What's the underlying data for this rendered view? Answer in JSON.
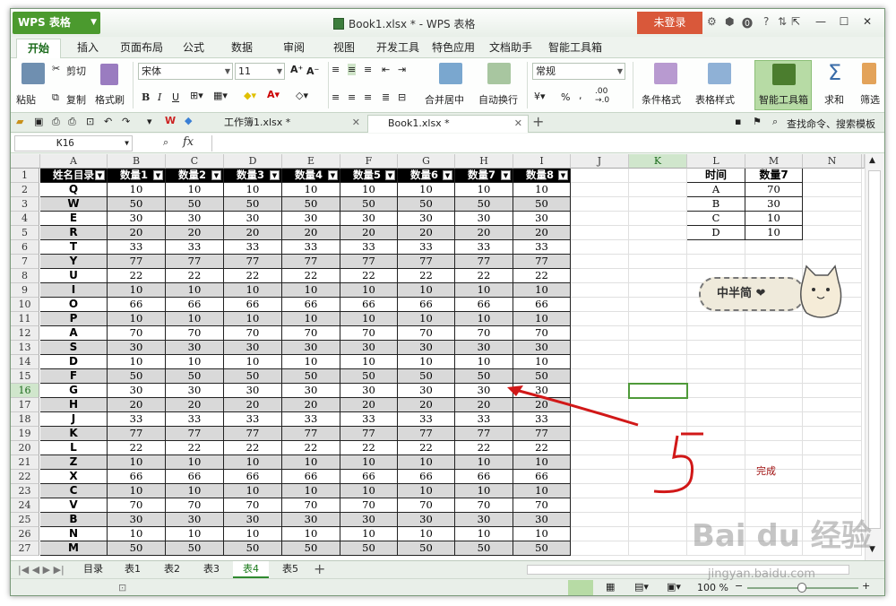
{
  "app": {
    "name": "WPS 表格",
    "window_title": "Book1.xlsx * - WPS 表格",
    "login": "未登录"
  },
  "menu": [
    "开始",
    "插入",
    "页面布局",
    "公式",
    "数据",
    "审阅",
    "视图",
    "开发工具",
    "特色应用",
    "文档助手",
    "智能工具箱"
  ],
  "ribbon": {
    "paste": "粘贴",
    "cut": "剪切",
    "copy": "复制",
    "format_painter": "格式刷",
    "font": "宋体",
    "size": "11",
    "bold": "B",
    "italic": "I",
    "underline": "U",
    "merge": "合并居中",
    "wrap": "自动换行",
    "number_format": "常规",
    "percent": "%",
    "comma": ",",
    "dec_inc": ".00",
    "dec_dec": "→.0",
    "cond_format": "条件格式",
    "table_style": "表格样式",
    "smart_box": "智能工具箱",
    "sum": "求和",
    "filter": "筛选"
  },
  "doc_tabs": [
    {
      "name": "工作簿1.xlsx *"
    },
    {
      "name": "Book1.xlsx *"
    }
  ],
  "search": "查找命令、搜索模板",
  "formula_bar": {
    "name_box": "K16",
    "fx": "fx",
    "content": ""
  },
  "columns": [
    "A",
    "B",
    "C",
    "D",
    "E",
    "F",
    "G",
    "H",
    "I",
    "J",
    "K",
    "L",
    "M",
    "N"
  ],
  "selected_col": "K",
  "selected_row": 16,
  "table": {
    "headers": [
      "姓名目录",
      "数量1",
      "数量2",
      "数量3",
      "数量4",
      "数量5",
      "数量6",
      "数量7",
      "数量8"
    ],
    "rows": [
      {
        "name": "Q",
        "v": 10
      },
      {
        "name": "W",
        "v": 50
      },
      {
        "name": "E",
        "v": 30
      },
      {
        "name": "R",
        "v": 20
      },
      {
        "name": "T",
        "v": 33
      },
      {
        "name": "Y",
        "v": 77
      },
      {
        "name": "U",
        "v": 22
      },
      {
        "name": "I",
        "v": 10
      },
      {
        "name": "O",
        "v": 66
      },
      {
        "name": "P",
        "v": 10
      },
      {
        "name": "A",
        "v": 70
      },
      {
        "name": "S",
        "v": 30
      },
      {
        "name": "D",
        "v": 10
      },
      {
        "name": "F",
        "v": 50
      },
      {
        "name": "G",
        "v": 30
      },
      {
        "name": "H",
        "v": 20
      },
      {
        "name": "J",
        "v": 33
      },
      {
        "name": "K",
        "v": 77
      },
      {
        "name": "L",
        "v": 22
      },
      {
        "name": "Z",
        "v": 10
      },
      {
        "name": "X",
        "v": 66
      },
      {
        "name": "C",
        "v": 10
      },
      {
        "name": "V",
        "v": 70
      },
      {
        "name": "B",
        "v": 30
      },
      {
        "name": "N",
        "v": 10
      },
      {
        "name": "M",
        "v": 50
      }
    ]
  },
  "side_table": {
    "headers": [
      "时间",
      "数量7"
    ],
    "rows": [
      [
        "A",
        "70"
      ],
      [
        "B",
        "30"
      ],
      [
        "C",
        "10"
      ],
      [
        "D",
        "10"
      ]
    ]
  },
  "annotation": {
    "done": "完成",
    "badge": "中半简 ❤"
  },
  "sheet_tabs": [
    "目录",
    "表1",
    "表2",
    "表3",
    "表4",
    "表5"
  ],
  "active_sheet": "表4",
  "status": {
    "zoom": "100 %"
  },
  "watermark": {
    "logo": "Bai du 经验",
    "url": "jingyan.baidu.com"
  }
}
